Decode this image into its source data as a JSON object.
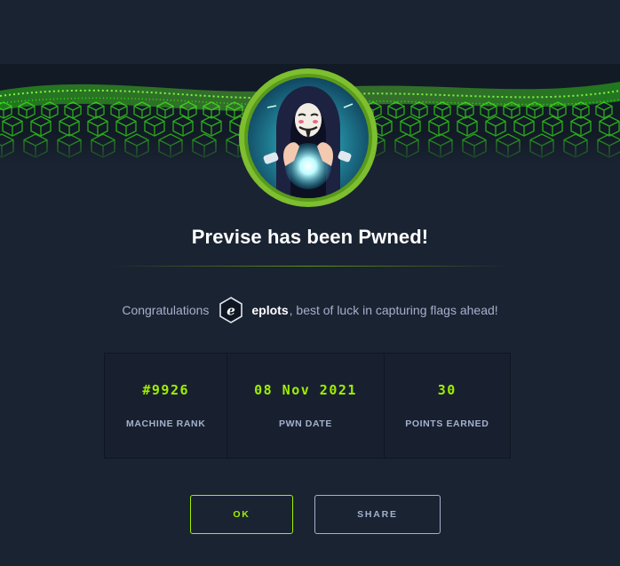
{
  "modal": {
    "title": "Previse has been Pwned!",
    "congrats_prefix": "Congratulations",
    "username": "eplots",
    "congrats_suffix": ", best of luck in capturing flags ahead!"
  },
  "stats": [
    {
      "value": "#9926",
      "label": "MACHINE RANK"
    },
    {
      "value": "08 Nov 2021",
      "label": "PWN DATE"
    },
    {
      "value": "30",
      "label": "POINTS EARNED"
    }
  ],
  "buttons": {
    "ok_label": "OK",
    "share_label": "SHARE"
  },
  "colors": {
    "background": "#1a2332",
    "accent_green": "#9fef00",
    "muted_text": "#a4b1cd",
    "title_text": "#ffffff"
  },
  "icons": {
    "banner": "green-cube-grid-banner",
    "avatar": "masked-hacker-crystal-ball-avatar",
    "user_badge": "user-rank-badge-icon"
  }
}
